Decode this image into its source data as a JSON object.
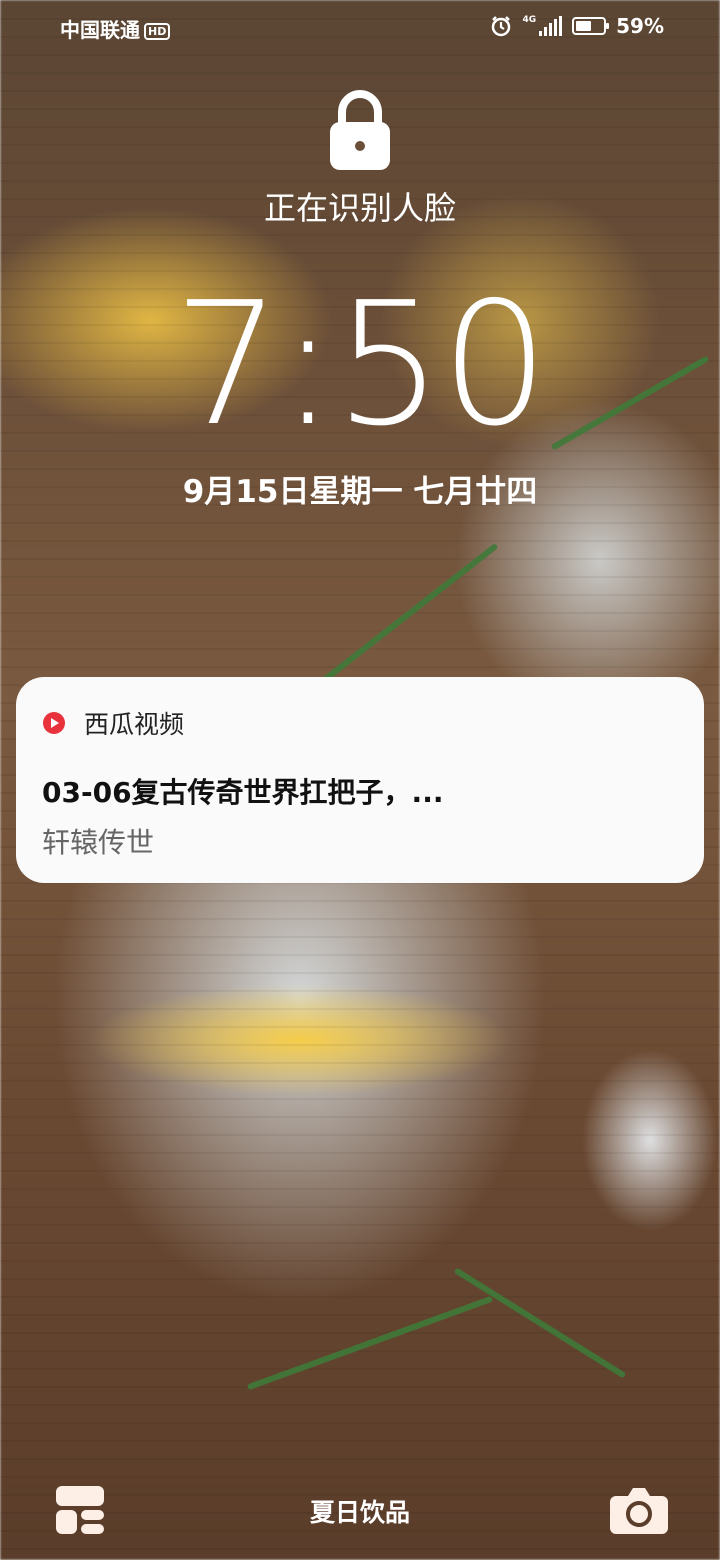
{
  "status_bar": {
    "carrier": "中国联通",
    "hd_badge": "HD",
    "network_type": "4G",
    "battery_percent": "59%",
    "battery_level": 0.59,
    "icons": [
      "alarm-icon",
      "signal-icon",
      "battery-icon"
    ]
  },
  "lockscreen": {
    "lock_icon": "lock-icon",
    "face_status": "正在识别人脸",
    "time": "7:50",
    "date": "9月15日星期一 七月廿四"
  },
  "notification": {
    "app_name": "西瓜视频",
    "app_icon": "xigua-video-icon",
    "title": "03-06复古传奇世界扛把子，...",
    "body": "轩辕传世"
  },
  "bottom_bar": {
    "left_icon": "widgets-icon",
    "wallpaper_label": "夏日饮品",
    "right_icon": "camera-icon"
  },
  "colors": {
    "accent": "#e8323c",
    "text_light": "#ffffff",
    "card_bg": "#fafafa"
  }
}
